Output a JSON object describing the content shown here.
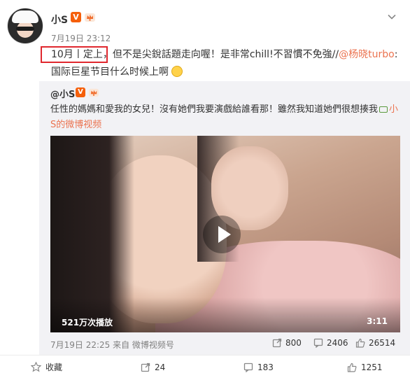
{
  "post": {
    "username": "小S",
    "v_badge": "V",
    "time": "7月19日 23:12",
    "text_part1": "10月丨定上",
    "text_part2": "，但不是尖銳話題走向喔！是非常chill!不習慣不免強//",
    "mention": "@杨晓turbo",
    "text_part3": ":国际巨星节目什么时候上啊"
  },
  "repost": {
    "username": "@小S",
    "v_badge": "V",
    "text": "任性的媽媽和愛我的女兒！沒有她們我要演戲給誰看那！雖然我知道她們很想揍我",
    "link_text": "小S的微博视频",
    "video": {
      "views": "521万次播放",
      "duration": "3:11"
    },
    "meta": "7月19日 22:25 来自 微博视频号",
    "forwards": "800",
    "comments": "2406",
    "likes": "26514"
  },
  "footer": {
    "favorite_label": "收藏",
    "forward_count": "24",
    "comment_count": "183",
    "like_count": "1251"
  },
  "colors": {
    "accent": "#eb7350",
    "highlight_box": "#e0282e",
    "verified": "#f55f0a"
  },
  "icons": [
    "chevron-down-icon",
    "verified-icon",
    "crown-icon",
    "emoji-icon",
    "video-link-icon",
    "play-icon",
    "forward-icon",
    "comment-icon",
    "like-icon",
    "favorite-icon"
  ]
}
